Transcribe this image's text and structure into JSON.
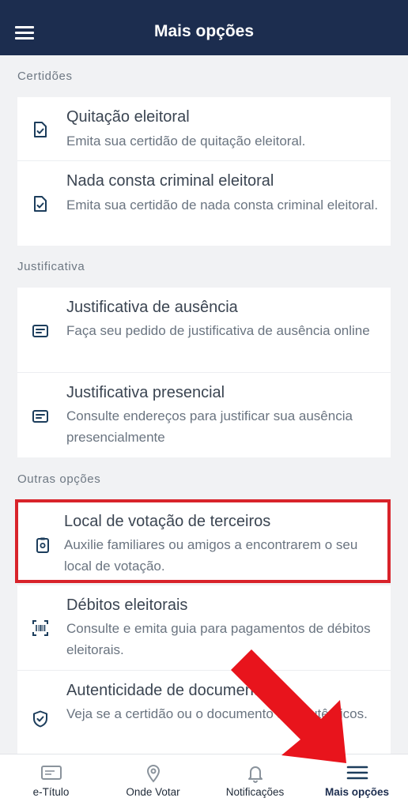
{
  "header": {
    "title": "Mais opções",
    "menu_icon": "hamburger-menu-icon"
  },
  "sections": {
    "certidoes": {
      "title": "Certidões",
      "items": [
        {
          "title": "Quitação eleitoral",
          "description": "Emita sua certidão de quitação eleitoral.",
          "icon": "document-check-icon"
        },
        {
          "title": "Nada consta criminal eleitoral",
          "description": "Emita sua certidão de nada consta criminal eleitoral.",
          "icon": "document-check-icon"
        }
      ]
    },
    "justificativa": {
      "title": "Justificativa",
      "items": [
        {
          "title": "Justificativa de ausência",
          "description": "Faça seu pedido de justificativa de ausência online",
          "icon": "message-card-icon"
        },
        {
          "title": "Justificativa presencial",
          "description": "Consulte endereços para justificar sua ausência presencialmente",
          "icon": "message-card-icon"
        }
      ]
    },
    "outras": {
      "title": "Outras opções",
      "items": [
        {
          "title": "Local de votação de terceiros",
          "description": "Auxilie familiares ou amigos a encontrarem o seu local de votação.",
          "icon": "clipboard-location-icon"
        },
        {
          "title": "Débitos eleitorais",
          "description": "Consulte e emita guia para pagamentos de débitos eleitorais.",
          "icon": "barcode-scan-icon"
        },
        {
          "title": "Autenticidade de documentos",
          "description": "Veja se a certidão ou o documento são autênticos.",
          "icon": "shield-check-icon"
        }
      ]
    }
  },
  "bottom_nav": {
    "items": [
      {
        "label": "e-Título",
        "icon": "id-card-icon",
        "active": false
      },
      {
        "label": "Onde Votar",
        "icon": "map-pin-icon",
        "active": false
      },
      {
        "label": "Notificações",
        "icon": "bell-icon",
        "active": false
      },
      {
        "label": "Mais opções",
        "icon": "hamburger-menu-icon",
        "active": true
      }
    ]
  },
  "colors": {
    "header_bg": "#1c2d4f",
    "icon": "#1c3d5c",
    "highlight_border": "#d8232a",
    "annotation_arrow": "#e8141c"
  }
}
